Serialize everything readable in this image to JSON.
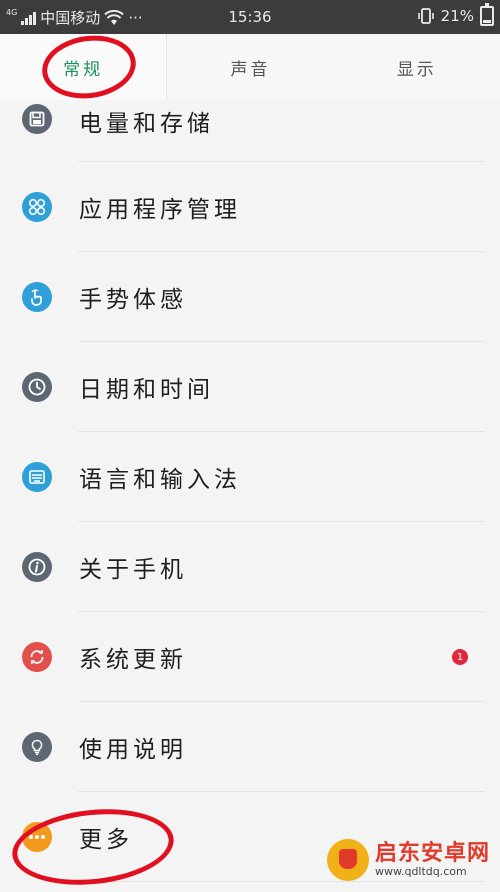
{
  "status_bar": {
    "network_type": "4G",
    "carrier": "中国移动",
    "more_indicator": "···",
    "time": "15:36",
    "battery_percent": "21%",
    "battery_level": 0.21
  },
  "tabs": [
    {
      "label": "常规",
      "active": true
    },
    {
      "label": "声音",
      "active": false
    },
    {
      "label": "显示",
      "active": false
    }
  ],
  "items": [
    {
      "label": "电量和存储",
      "icon": "storage-icon",
      "color": "#5d6773"
    },
    {
      "label": "应用程序管理",
      "icon": "apps-icon",
      "color": "#2f9fd8"
    },
    {
      "label": "手势体感",
      "icon": "gesture-icon",
      "color": "#2f9fd8"
    },
    {
      "label": "日期和时间",
      "icon": "clock-icon",
      "color": "#5d6773"
    },
    {
      "label": "语言和输入法",
      "icon": "keyboard-icon",
      "color": "#2f9fd8"
    },
    {
      "label": "关于手机",
      "icon": "info-icon",
      "color": "#5d6773"
    },
    {
      "label": "系统更新",
      "icon": "update-icon",
      "color": "#e2504e",
      "badge": "1"
    },
    {
      "label": "使用说明",
      "icon": "lightbulb-icon",
      "color": "#5d6773"
    },
    {
      "label": "更多",
      "icon": "more-icon",
      "color": "#f39a1e"
    }
  ],
  "watermark": {
    "title": "启东安卓网",
    "url": "www.qdltdq.com"
  },
  "colors": {
    "active_tab": "#1d8f5e",
    "annotation": "#e01020",
    "status_bar_bg": "#3c3c3c"
  }
}
